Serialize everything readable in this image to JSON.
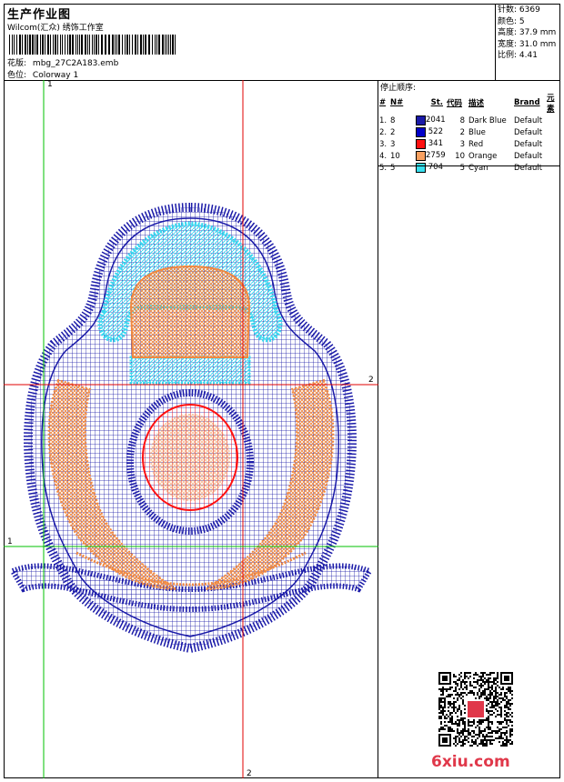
{
  "header": {
    "title": "生产作业图",
    "company": "Wilcom(汇众) 绣饰工作室",
    "design_label": "花版:",
    "design_value": "mbg_27C2A183.emb",
    "colorway_label": "色位:",
    "colorway_value": "Colorway 1"
  },
  "stats": {
    "stitches": "针数: 6369",
    "colors": "颜色: 5",
    "height": "高度: 37.9 mm",
    "width": "宽度: 31.0 mm",
    "scale": "比例: 4.41"
  },
  "stop_sequence": {
    "title": "停止顺序:",
    "headers": [
      "#",
      "N#",
      "St.",
      "代码",
      "描述",
      "Brand",
      "元素"
    ],
    "rows": [
      {
        "idx": "1.",
        "n": "8",
        "st": "2041",
        "code": "8",
        "desc": "Dark Blue",
        "brand": "Default",
        "color": "#1a1aa8"
      },
      {
        "idx": "2.",
        "n": "2",
        "st": "522",
        "code": "2",
        "desc": "Blue",
        "brand": "Default",
        "color": "#0000c8"
      },
      {
        "idx": "3.",
        "n": "3",
        "st": "341",
        "code": "3",
        "desc": "Red",
        "brand": "Default",
        "color": "#ff1010"
      },
      {
        "idx": "4.",
        "n": "10",
        "st": "2759",
        "code": "10",
        "desc": "Orange",
        "brand": "Default",
        "color": "#f8a060"
      },
      {
        "idx": "5.",
        "n": "5",
        "st": "704",
        "code": "5",
        "desc": "Cyan",
        "brand": "Default",
        "color": "#38e0f0"
      }
    ]
  },
  "axes": {
    "v1": "1",
    "v2": "2",
    "h1": "1",
    "h2": "2"
  },
  "watermark": "6xiu.com",
  "colors": {
    "dark_blue": "#1a1aa8",
    "blue": "#0000c8",
    "red": "#ff1010",
    "orange": "#f8a060",
    "cyan": "#38e0f0",
    "guide_green": "#00c000",
    "guide_red": "#e00000"
  }
}
